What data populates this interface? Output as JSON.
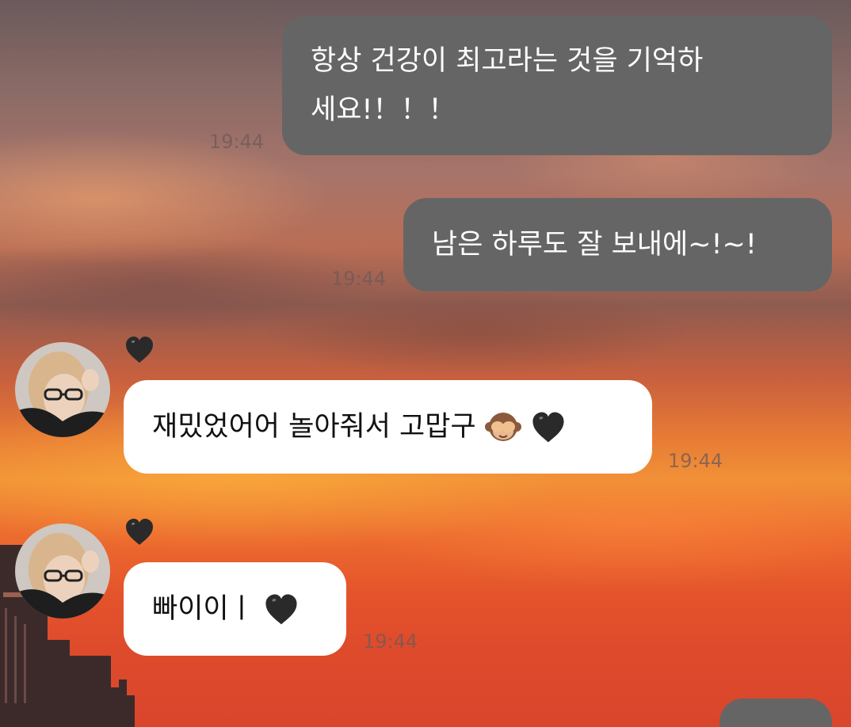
{
  "messages": [
    {
      "from": "me",
      "text_line1": "항상 건강이 최고라는 것을 기억하",
      "text_line2": "세요!！！！",
      "time": "19:44"
    },
    {
      "from": "me",
      "text": "남은 하루도 잘 보내에~!~!",
      "time": "19:44"
    },
    {
      "from": "other",
      "text": "재밌었어어 놀아줘서 고맙구",
      "time": "19:44",
      "emojis": [
        "see-no-evil-monkey",
        "black-heart"
      ],
      "reaction": "black-heart"
    },
    {
      "from": "other",
      "text": "빠이이ㅣ",
      "time": "19:44",
      "emojis": [
        "black-heart"
      ],
      "reaction": "black-heart"
    }
  ],
  "colors": {
    "sent_bubble": "#666565",
    "received_bubble": "#ffffff",
    "timestamp": "#8a6a68"
  }
}
